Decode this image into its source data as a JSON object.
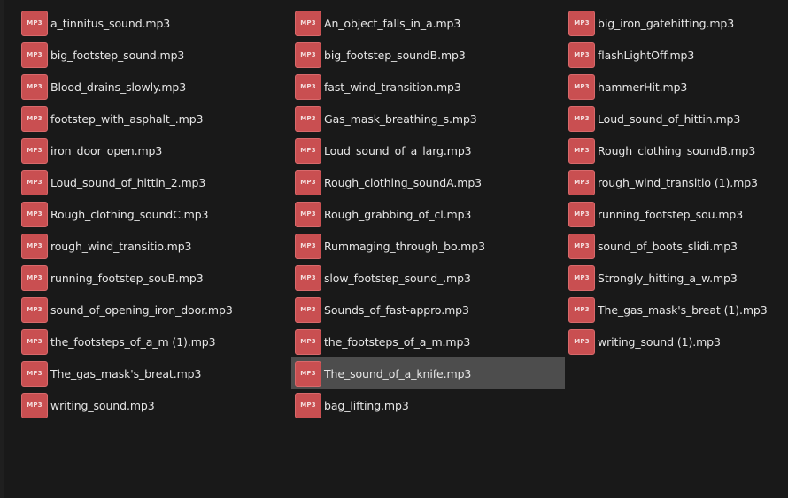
{
  "icon_label": "MP3",
  "files": [
    "a_tinnitus_sound.mp3",
    "big_footstep_sound.mp3",
    "Blood_drains_slowly.mp3",
    "footstep_with_asphalt_.mp3",
    "iron_door_open.mp3",
    "Loud_sound_of_hittin_2.mp3",
    "Rough_clothing_soundC.mp3",
    "rough_wind_transitio.mp3",
    "running_footstep_souB.mp3",
    "sound_of_opening_iron_door.mp3",
    "the_footsteps_of_a_m (1).mp3",
    "The_gas_mask's_breat.mp3",
    "writing_sound.mp3",
    "An_object_falls_in_a.mp3",
    "big_footstep_soundB.mp3",
    "fast_wind_transition.mp3",
    "Gas_mask_breathing_s.mp3",
    "Loud_sound_of_a_larg.mp3",
    "Rough_clothing_soundA.mp3",
    "Rough_grabbing_of_cl.mp3",
    "Rummaging_through_bo.mp3",
    "slow_footstep_sound_.mp3",
    "Sounds_of_fast-appro.mp3",
    "the_footsteps_of_a_m.mp3",
    "The_sound_of_a_knife.mp3",
    "bag_lifting.mp3",
    "big_iron_gatehitting.mp3",
    "flashLightOff.mp3",
    "hammerHit.mp3",
    "Loud_sound_of_hittin.mp3",
    "Rough_clothing_soundB.mp3",
    "rough_wind_transitio (1).mp3",
    "running_footstep_sou.mp3",
    "sound_of_boots_slidi.mp3",
    "Strongly_hitting_a_w.mp3",
    "The_gas_mask's_breat (1).mp3",
    "writing_sound (1).mp3"
  ],
  "selected_file": "The_sound_of_a_knife.mp3",
  "colors": {
    "background": "#191919",
    "selection": "#4d4d4d",
    "icon": "#c94f51",
    "text": "#e6e6e6"
  },
  "icons": {
    "file": "mp3-file-icon"
  }
}
